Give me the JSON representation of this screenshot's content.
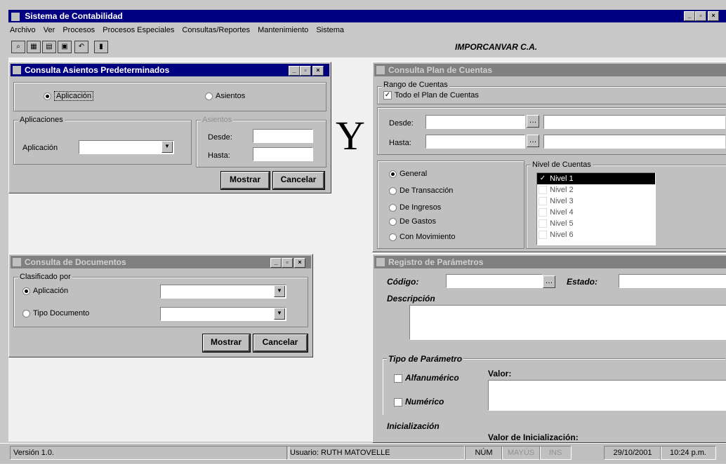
{
  "app": {
    "title": "Sistema de Contabilidad",
    "company": "IMPORCANVAR C.A."
  },
  "menu": [
    "Archivo",
    "Ver",
    "Procesos",
    "Procesos Especiales",
    "Consultas/Reportes",
    "Mantenimiento",
    "Sistema"
  ],
  "win_asientos": {
    "title": "Consulta Asientos Predeterminados",
    "radio_aplicacion": "Aplicación",
    "radio_asientos": "Asientos",
    "group_aplicaciones": "Aplicaciones",
    "aplicacion_label": "Aplicación",
    "group_asientos": "Asientos",
    "desde_label": "Desde:",
    "hasta_label": "Hasta:",
    "mostrar": "Mostrar",
    "cancelar": "Cancelar"
  },
  "win_documentos": {
    "title": "Consulta de Documentos",
    "group_label": "Clasificado por",
    "radio_aplicacion": "Aplicación",
    "radio_tipo": "Tipo Documento",
    "mostrar": "Mostrar",
    "cancelar": "Cancelar"
  },
  "win_plan": {
    "title": "Consulta Plan de Cuentas",
    "group_rango": "Rango de Cuentas",
    "todo_label": "Todo el Plan de Cuentas",
    "desde_label": "Desde:",
    "hasta_label": "Hasta:",
    "radios": [
      "General",
      "De Transacción",
      "De Ingresos",
      "De Gastos",
      "Con Movimiento"
    ],
    "group_nivel": "Nivel de Cuentas",
    "niveles": [
      "Nivel 1",
      "Nivel 2",
      "Nivel 3",
      "Nivel 4",
      "Nivel 5",
      "Nivel 6"
    ]
  },
  "win_parametros": {
    "title": "Registro de Parámetros",
    "codigo_label": "Código:",
    "estado_label": "Estado:",
    "descripcion_label": "Descripción",
    "tipo_label": "Tipo de Parámetro",
    "alfanumerico": "Alfanumérico",
    "numerico": "Numérico",
    "valor_label": "Valor:",
    "inicializacion_label": "Inicialización",
    "valor_inicializacion": "Valor de Inicialización:"
  },
  "status": {
    "version": "Versión 1.0.",
    "usuario": "Usuario:  RUTH MATOVELLE",
    "num": "NÚM",
    "mayus": "MAYÚS",
    "ins": "INS",
    "fecha": "29/10/2001",
    "hora": "10:24 p.m."
  },
  "colors": {
    "titlebar_active": "#000080",
    "titlebar_inactive": "#808080",
    "face": "#c0c0c0"
  }
}
